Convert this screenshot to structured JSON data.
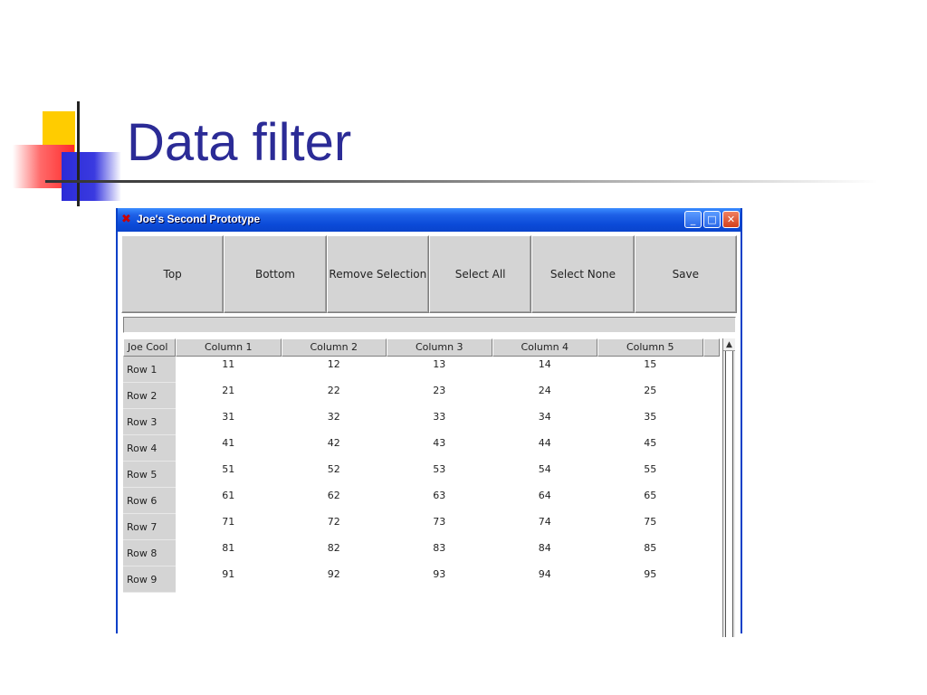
{
  "slide": {
    "title": "Data filter"
  },
  "window": {
    "title": "Joe's Second Prototype",
    "controls": {
      "minimize": "_",
      "maximize": "□",
      "close": "✕"
    }
  },
  "toolbar": {
    "buttons": [
      "Top",
      "Bottom",
      "Remove Selection",
      "Select All",
      "Select None",
      "Save"
    ]
  },
  "table": {
    "corner": "Joe Cool",
    "columns": [
      "Column 1",
      "Column 2",
      "Column 3",
      "Column 4",
      "Column 5"
    ],
    "rows": [
      {
        "label": "Row 1",
        "cells": [
          "11",
          "12",
          "13",
          "14",
          "15"
        ]
      },
      {
        "label": "Row 2",
        "cells": [
          "21",
          "22",
          "23",
          "24",
          "25"
        ]
      },
      {
        "label": "Row 3",
        "cells": [
          "31",
          "32",
          "33",
          "34",
          "35"
        ]
      },
      {
        "label": "Row 4",
        "cells": [
          "41",
          "42",
          "43",
          "44",
          "45"
        ]
      },
      {
        "label": "Row 5",
        "cells": [
          "51",
          "52",
          "53",
          "54",
          "55"
        ]
      },
      {
        "label": "Row 6",
        "cells": [
          "61",
          "62",
          "63",
          "64",
          "65"
        ]
      },
      {
        "label": "Row 7",
        "cells": [
          "71",
          "72",
          "73",
          "74",
          "75"
        ]
      },
      {
        "label": "Row 8",
        "cells": [
          "81",
          "82",
          "83",
          "84",
          "85"
        ]
      },
      {
        "label": "Row 9",
        "cells": [
          "91",
          "92",
          "93",
          "94",
          "95"
        ]
      }
    ]
  },
  "scrollbar": {
    "up_arrow": "▲"
  }
}
